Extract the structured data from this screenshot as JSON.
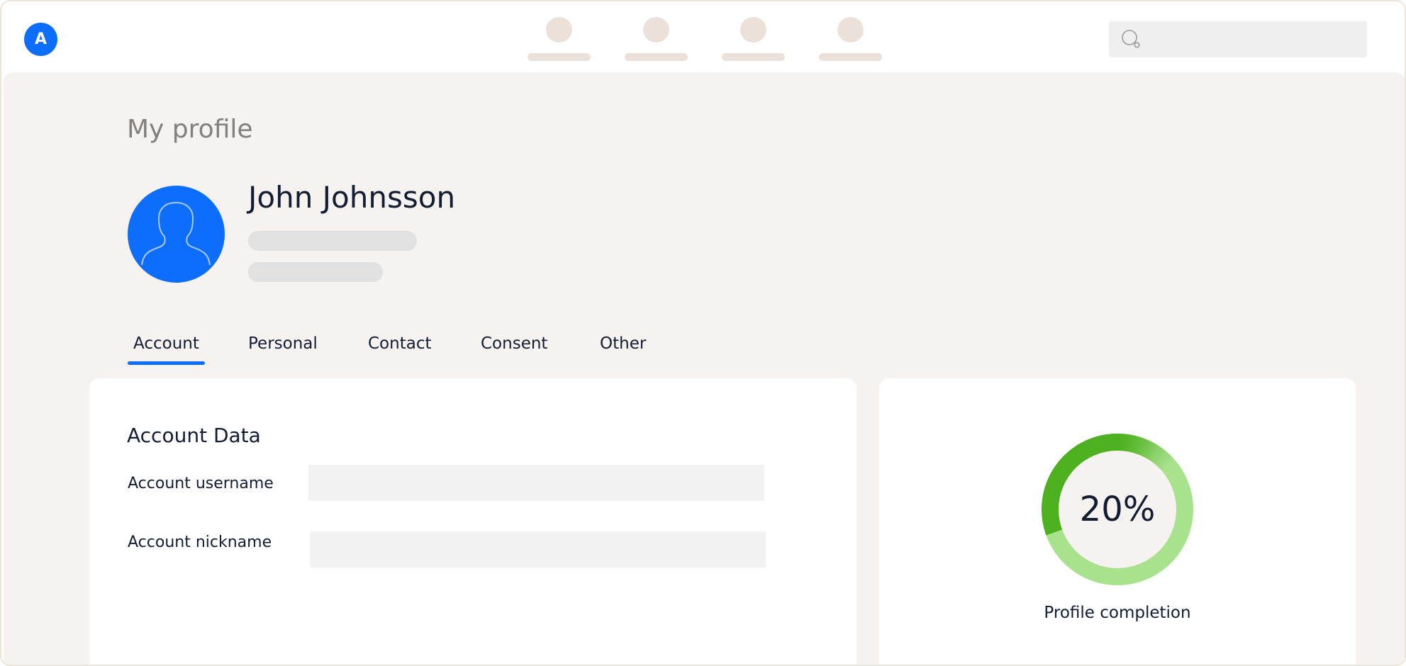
{
  "brand": {
    "logo_letter": "A",
    "accent_color": "#0d6efd"
  },
  "nav": {
    "item_count": 4
  },
  "search": {
    "placeholder": ""
  },
  "page": {
    "title": "My profile"
  },
  "profile": {
    "name": "John Johnsson"
  },
  "tabs": [
    {
      "label": "Account",
      "active": true
    },
    {
      "label": "Personal",
      "active": false
    },
    {
      "label": "Contact",
      "active": false
    },
    {
      "label": "Consent",
      "active": false
    },
    {
      "label": "Other",
      "active": false
    }
  ],
  "account_card": {
    "title": "Account Data",
    "fields": [
      {
        "label": "Account username",
        "value": ""
      },
      {
        "label": "Account nickname",
        "value": ""
      }
    ]
  },
  "completion": {
    "value_text": "20%",
    "percent": 20,
    "label": "Profile completion",
    "ring_color": "#4cb01f",
    "ring_track_color": "#a9e28d"
  }
}
